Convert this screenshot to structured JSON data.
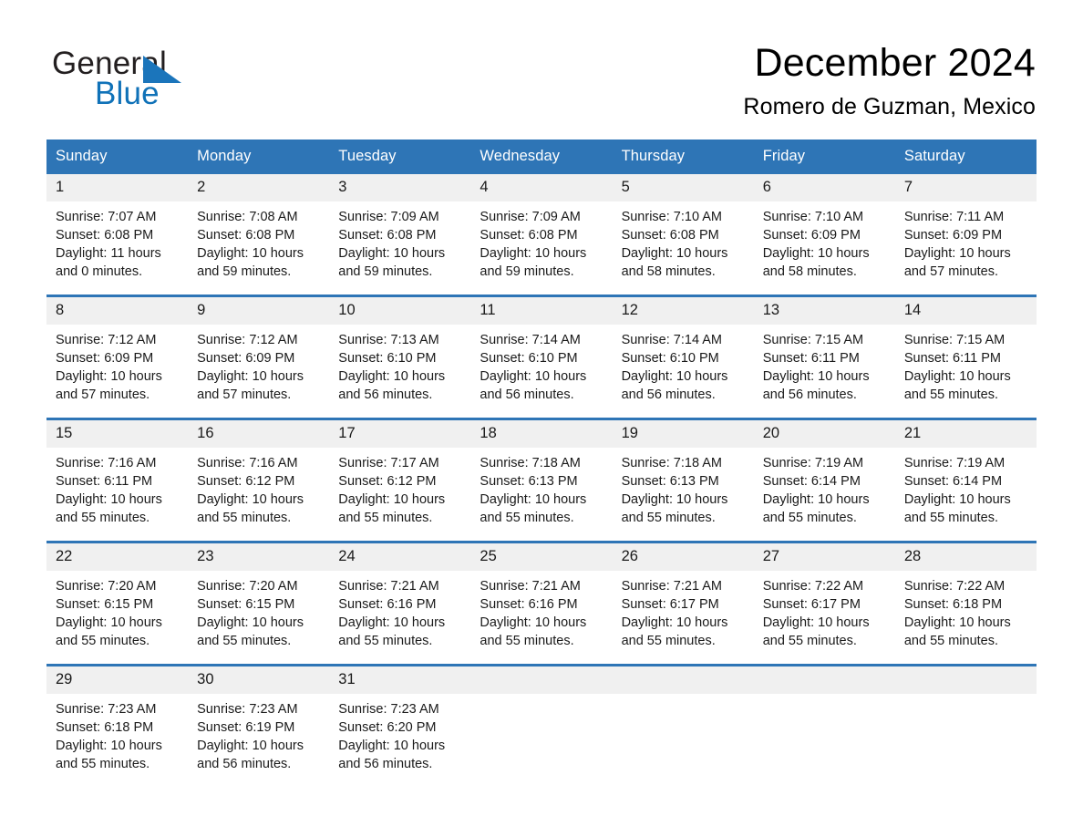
{
  "brand": {
    "name_top": "General",
    "name_bottom": "Blue",
    "color_black": "#231f20",
    "color_blue": "#1072b8"
  },
  "header": {
    "month_title": "December 2024",
    "location": "Romero de Guzman, Mexico"
  },
  "theme": {
    "header_blue": "#2E75B6",
    "row_rule_blue": "#2E75B6",
    "day_strip_gray": "#F0F0F0"
  },
  "weekdays": [
    "Sunday",
    "Monday",
    "Tuesday",
    "Wednesday",
    "Thursday",
    "Friday",
    "Saturday"
  ],
  "weeks": [
    [
      {
        "day": "1",
        "sunrise": "Sunrise: 7:07 AM",
        "sunset": "Sunset: 6:08 PM",
        "daylight": "Daylight: 11 hours and 0 minutes."
      },
      {
        "day": "2",
        "sunrise": "Sunrise: 7:08 AM",
        "sunset": "Sunset: 6:08 PM",
        "daylight": "Daylight: 10 hours and 59 minutes."
      },
      {
        "day": "3",
        "sunrise": "Sunrise: 7:09 AM",
        "sunset": "Sunset: 6:08 PM",
        "daylight": "Daylight: 10 hours and 59 minutes."
      },
      {
        "day": "4",
        "sunrise": "Sunrise: 7:09 AM",
        "sunset": "Sunset: 6:08 PM",
        "daylight": "Daylight: 10 hours and 59 minutes."
      },
      {
        "day": "5",
        "sunrise": "Sunrise: 7:10 AM",
        "sunset": "Sunset: 6:08 PM",
        "daylight": "Daylight: 10 hours and 58 minutes."
      },
      {
        "day": "6",
        "sunrise": "Sunrise: 7:10 AM",
        "sunset": "Sunset: 6:09 PM",
        "daylight": "Daylight: 10 hours and 58 minutes."
      },
      {
        "day": "7",
        "sunrise": "Sunrise: 7:11 AM",
        "sunset": "Sunset: 6:09 PM",
        "daylight": "Daylight: 10 hours and 57 minutes."
      }
    ],
    [
      {
        "day": "8",
        "sunrise": "Sunrise: 7:12 AM",
        "sunset": "Sunset: 6:09 PM",
        "daylight": "Daylight: 10 hours and 57 minutes."
      },
      {
        "day": "9",
        "sunrise": "Sunrise: 7:12 AM",
        "sunset": "Sunset: 6:09 PM",
        "daylight": "Daylight: 10 hours and 57 minutes."
      },
      {
        "day": "10",
        "sunrise": "Sunrise: 7:13 AM",
        "sunset": "Sunset: 6:10 PM",
        "daylight": "Daylight: 10 hours and 56 minutes."
      },
      {
        "day": "11",
        "sunrise": "Sunrise: 7:14 AM",
        "sunset": "Sunset: 6:10 PM",
        "daylight": "Daylight: 10 hours and 56 minutes."
      },
      {
        "day": "12",
        "sunrise": "Sunrise: 7:14 AM",
        "sunset": "Sunset: 6:10 PM",
        "daylight": "Daylight: 10 hours and 56 minutes."
      },
      {
        "day": "13",
        "sunrise": "Sunrise: 7:15 AM",
        "sunset": "Sunset: 6:11 PM",
        "daylight": "Daylight: 10 hours and 56 minutes."
      },
      {
        "day": "14",
        "sunrise": "Sunrise: 7:15 AM",
        "sunset": "Sunset: 6:11 PM",
        "daylight": "Daylight: 10 hours and 55 minutes."
      }
    ],
    [
      {
        "day": "15",
        "sunrise": "Sunrise: 7:16 AM",
        "sunset": "Sunset: 6:11 PM",
        "daylight": "Daylight: 10 hours and 55 minutes."
      },
      {
        "day": "16",
        "sunrise": "Sunrise: 7:16 AM",
        "sunset": "Sunset: 6:12 PM",
        "daylight": "Daylight: 10 hours and 55 minutes."
      },
      {
        "day": "17",
        "sunrise": "Sunrise: 7:17 AM",
        "sunset": "Sunset: 6:12 PM",
        "daylight": "Daylight: 10 hours and 55 minutes."
      },
      {
        "day": "18",
        "sunrise": "Sunrise: 7:18 AM",
        "sunset": "Sunset: 6:13 PM",
        "daylight": "Daylight: 10 hours and 55 minutes."
      },
      {
        "day": "19",
        "sunrise": "Sunrise: 7:18 AM",
        "sunset": "Sunset: 6:13 PM",
        "daylight": "Daylight: 10 hours and 55 minutes."
      },
      {
        "day": "20",
        "sunrise": "Sunrise: 7:19 AM",
        "sunset": "Sunset: 6:14 PM",
        "daylight": "Daylight: 10 hours and 55 minutes."
      },
      {
        "day": "21",
        "sunrise": "Sunrise: 7:19 AM",
        "sunset": "Sunset: 6:14 PM",
        "daylight": "Daylight: 10 hours and 55 minutes."
      }
    ],
    [
      {
        "day": "22",
        "sunrise": "Sunrise: 7:20 AM",
        "sunset": "Sunset: 6:15 PM",
        "daylight": "Daylight: 10 hours and 55 minutes."
      },
      {
        "day": "23",
        "sunrise": "Sunrise: 7:20 AM",
        "sunset": "Sunset: 6:15 PM",
        "daylight": "Daylight: 10 hours and 55 minutes."
      },
      {
        "day": "24",
        "sunrise": "Sunrise: 7:21 AM",
        "sunset": "Sunset: 6:16 PM",
        "daylight": "Daylight: 10 hours and 55 minutes."
      },
      {
        "day": "25",
        "sunrise": "Sunrise: 7:21 AM",
        "sunset": "Sunset: 6:16 PM",
        "daylight": "Daylight: 10 hours and 55 minutes."
      },
      {
        "day": "26",
        "sunrise": "Sunrise: 7:21 AM",
        "sunset": "Sunset: 6:17 PM",
        "daylight": "Daylight: 10 hours and 55 minutes."
      },
      {
        "day": "27",
        "sunrise": "Sunrise: 7:22 AM",
        "sunset": "Sunset: 6:17 PM",
        "daylight": "Daylight: 10 hours and 55 minutes."
      },
      {
        "day": "28",
        "sunrise": "Sunrise: 7:22 AM",
        "sunset": "Sunset: 6:18 PM",
        "daylight": "Daylight: 10 hours and 55 minutes."
      }
    ],
    [
      {
        "day": "29",
        "sunrise": "Sunrise: 7:23 AM",
        "sunset": "Sunset: 6:18 PM",
        "daylight": "Daylight: 10 hours and 55 minutes."
      },
      {
        "day": "30",
        "sunrise": "Sunrise: 7:23 AM",
        "sunset": "Sunset: 6:19 PM",
        "daylight": "Daylight: 10 hours and 56 minutes."
      },
      {
        "day": "31",
        "sunrise": "Sunrise: 7:23 AM",
        "sunset": "Sunset: 6:20 PM",
        "daylight": "Daylight: 10 hours and 56 minutes."
      },
      {
        "day": "",
        "sunrise": "",
        "sunset": "",
        "daylight": ""
      },
      {
        "day": "",
        "sunrise": "",
        "sunset": "",
        "daylight": ""
      },
      {
        "day": "",
        "sunrise": "",
        "sunset": "",
        "daylight": ""
      },
      {
        "day": "",
        "sunrise": "",
        "sunset": "",
        "daylight": ""
      }
    ]
  ]
}
